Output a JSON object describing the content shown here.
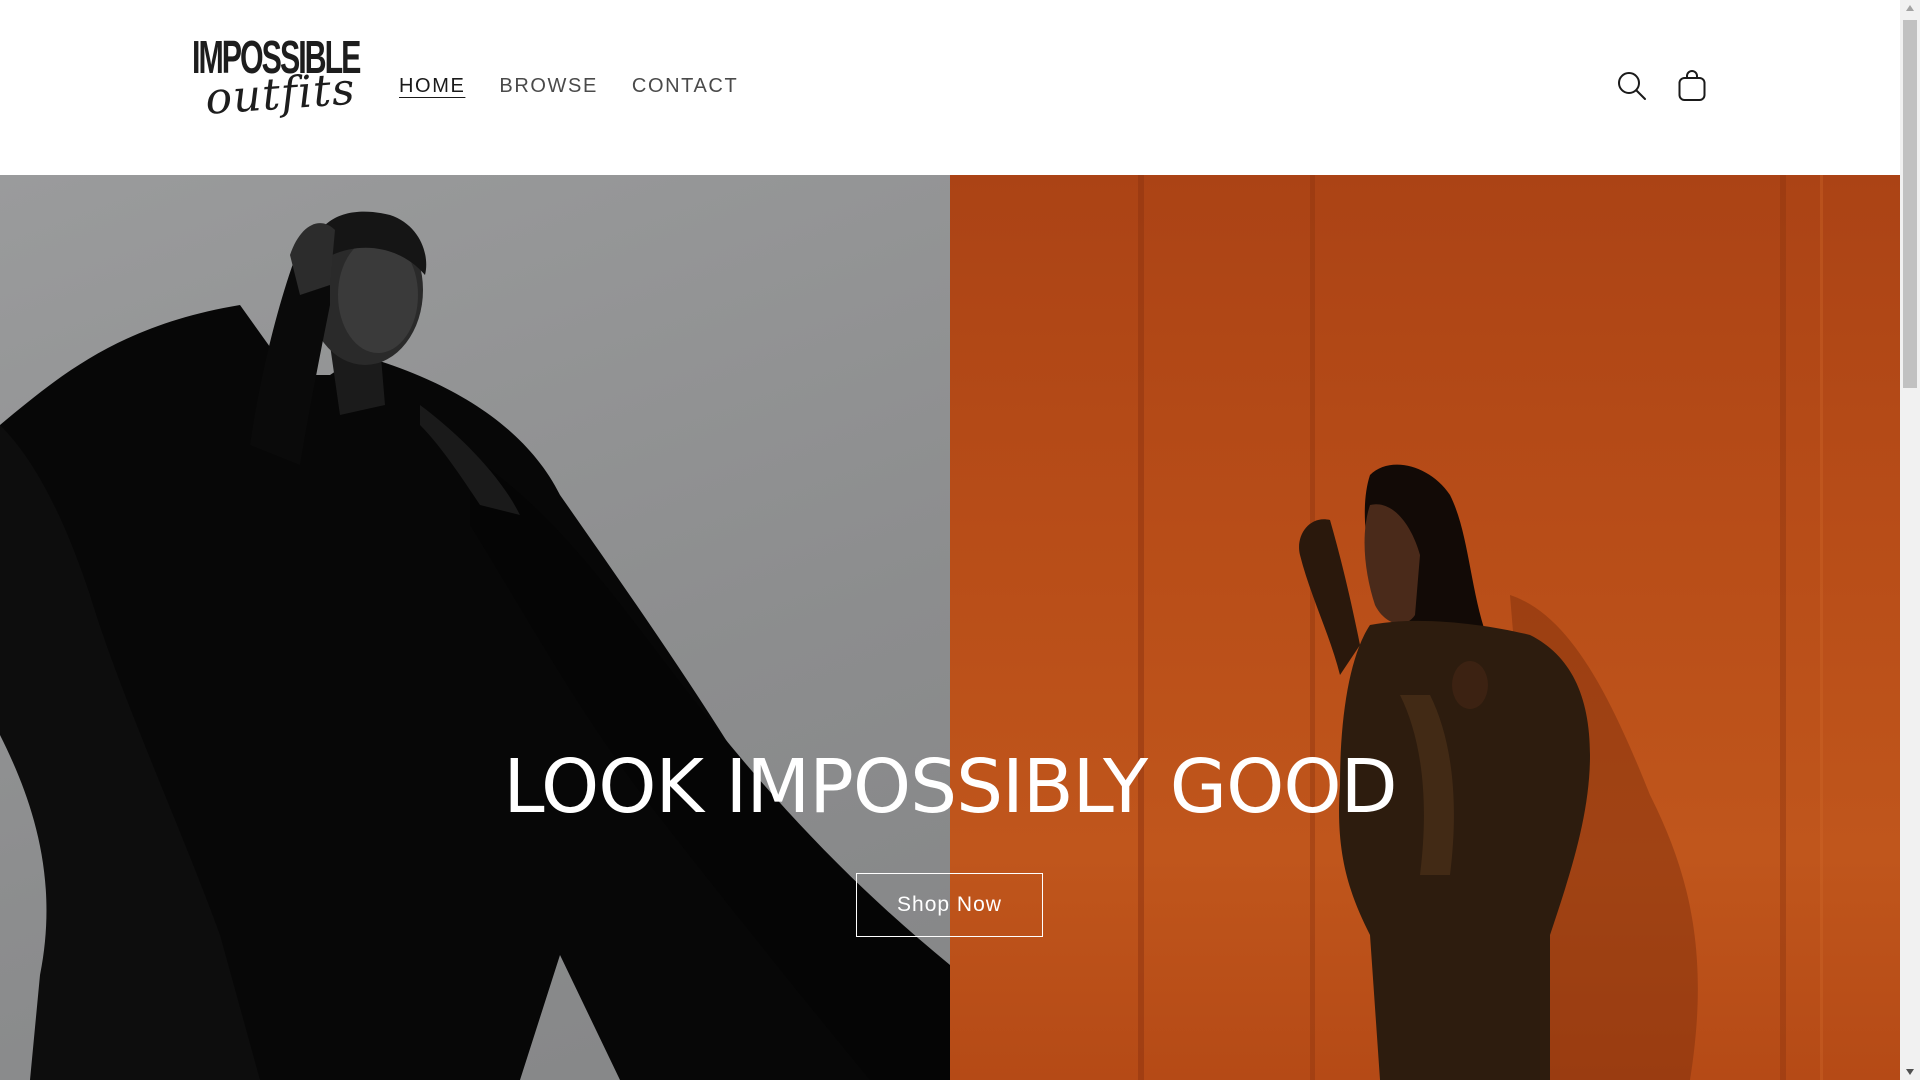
{
  "brand": {
    "logo_line1": "IMPOSSIBLE",
    "logo_line2": "outfits"
  },
  "nav": {
    "items": [
      {
        "label": "HOME",
        "active": true
      },
      {
        "label": "BROWSE",
        "active": false
      },
      {
        "label": "CONTACT",
        "active": false
      }
    ]
  },
  "header_icons": {
    "search": "search-icon",
    "cart": "cart-icon"
  },
  "hero": {
    "title": "LOOK IMPOSSIBLY GOOD",
    "button_label": "Shop Now",
    "left_image": "model in black oversized coat on grey background",
    "right_image": "model in dark satin dress against orange wall"
  },
  "colors": {
    "text_dark": "#1a1a1a",
    "nav_text": "#4a4a4a",
    "hero_text": "#ffffff",
    "left_panel": "#939495",
    "right_panel": "#b84d18"
  }
}
